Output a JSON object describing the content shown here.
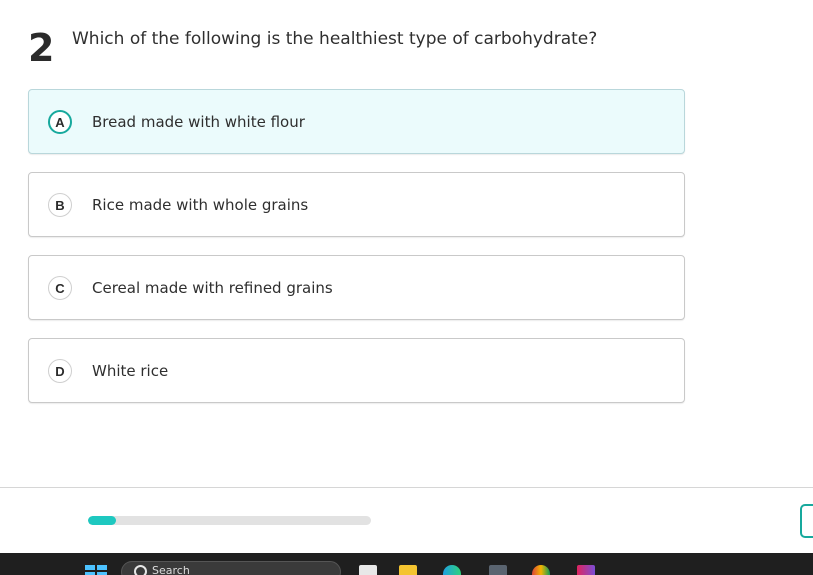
{
  "question": {
    "number": "2",
    "text": "Which of the following is the healthiest type of carbohydrate?"
  },
  "options": [
    {
      "letter": "A",
      "label": "Bread made with white flour",
      "selected": true
    },
    {
      "letter": "B",
      "label": "Rice made with whole grains",
      "selected": false
    },
    {
      "letter": "C",
      "label": "Cereal made with refined grains",
      "selected": false
    },
    {
      "letter": "D",
      "label": "White rice",
      "selected": false
    }
  ],
  "progress": {
    "fraction": 0.1
  },
  "colors": {
    "accent": "#17a99d",
    "progress_fill": "#1ec8c0",
    "selected_bg": "#ebfbfc"
  },
  "taskbar": {
    "search_label": "Search",
    "icons": [
      "windows-start-icon",
      "search-icon",
      "file-icon",
      "file-explorer-icon",
      "edge-browser-icon",
      "calculator-icon",
      "chrome-icon",
      "paint-icon"
    ]
  }
}
